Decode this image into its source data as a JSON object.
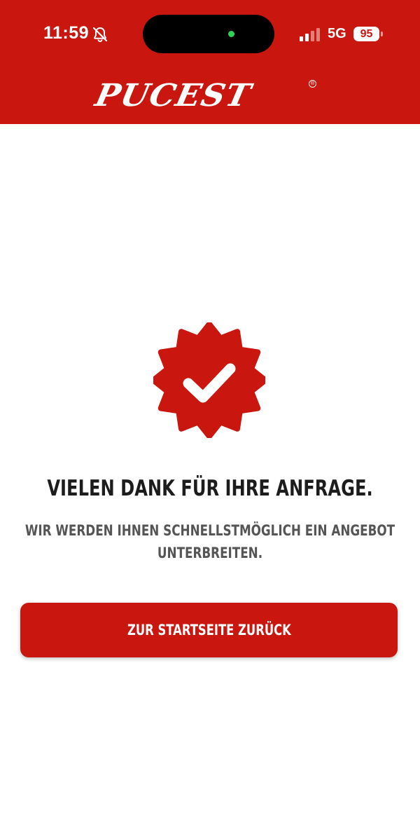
{
  "status_bar": {
    "time": "11:59",
    "network": "5G",
    "battery": "95",
    "silent_icon": "bell-slash-icon",
    "signal_icon": "cellular-signal-icon"
  },
  "header": {
    "logo_text": "PUCEST",
    "logo_registered": "®",
    "background_color": "#c9160e"
  },
  "confirmation": {
    "badge_icon": "verified-checkmark-badge-icon",
    "title": "VIELEN DANK FÜR IHRE ANFRAGE.",
    "message": "WIR WERDEN IHNEN SCHNELLSTMÖGLICH EIN ANGEBOT UNTERBREITEN."
  },
  "actions": {
    "home_button_label": "ZUR STARTSEITE ZURÜCK"
  },
  "colors": {
    "accent": "#c9160e",
    "title_text": "#1c1c1c",
    "body_text": "#555555"
  }
}
